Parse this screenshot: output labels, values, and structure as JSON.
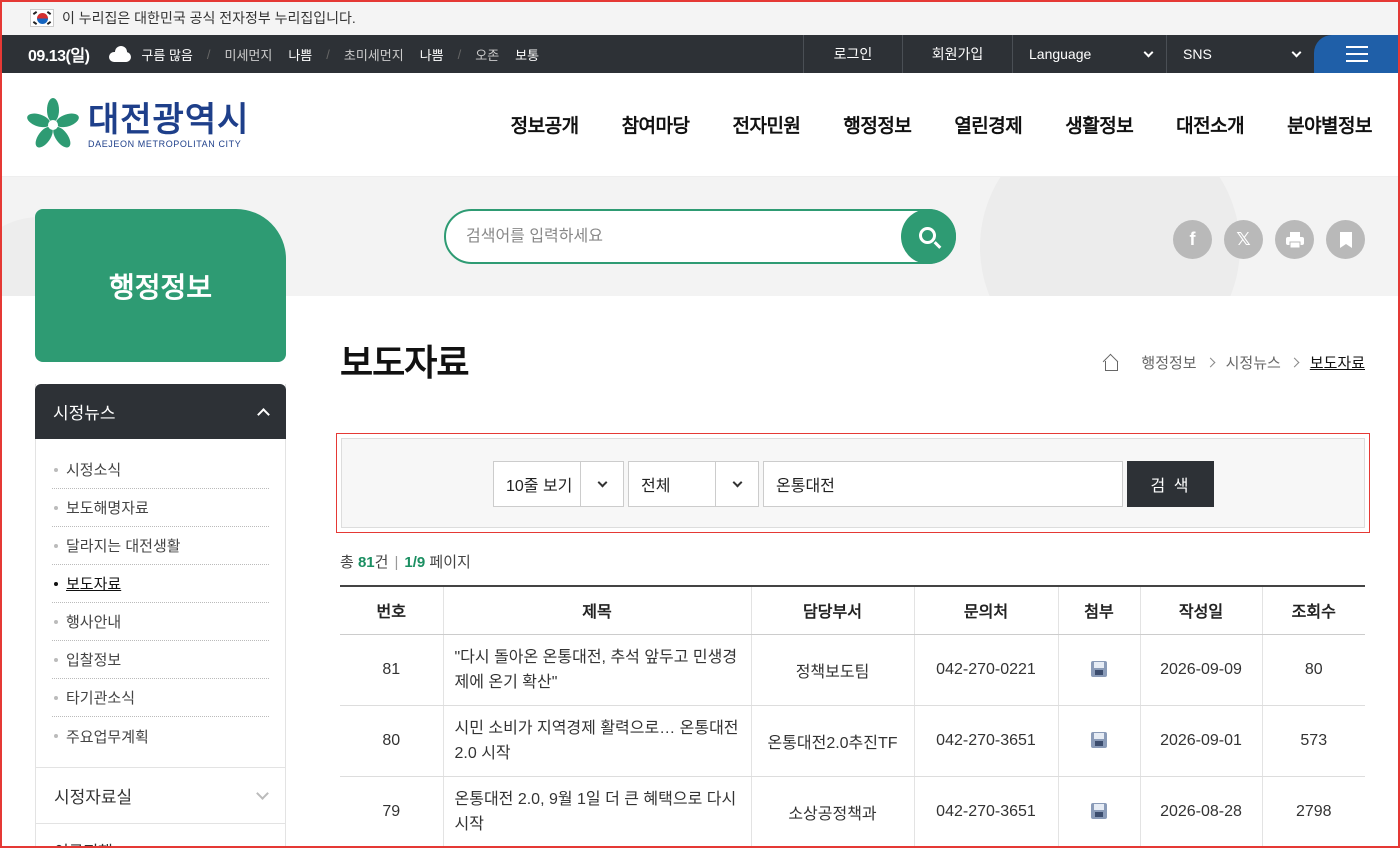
{
  "gov_banner": {
    "text": "이 누리집은 대한민국 공식 전자정부 누리집입니다."
  },
  "topbar": {
    "date": "09.13(일)",
    "weather": "구름 많음",
    "fine_dust_label": "미세먼지",
    "fine_dust_value": "나쁨",
    "ultrafine_label": "초미세먼지",
    "ultrafine_value": "나쁨",
    "ozone_label": "오존",
    "ozone_value": "보통",
    "login": "로그인",
    "signup": "회원가입",
    "language": "Language",
    "sns": "SNS"
  },
  "header": {
    "logo_ko": "대전광역시",
    "logo_en": "DAEJEON METROPOLITAN CITY",
    "gnb": [
      "정보공개",
      "참여마당",
      "전자민원",
      "행정정보",
      "열린경제",
      "생활정보",
      "대전소개",
      "분야별정보"
    ]
  },
  "search": {
    "placeholder": "검색어를 입력하세요"
  },
  "side": {
    "title": "행정정보",
    "section": "시정뉴스",
    "items": [
      "시정소식",
      "보도해명자료",
      "달라지는 대전생활",
      "보도자료",
      "행사안내",
      "입찰정보",
      "타기관소식",
      "주요업무계획"
    ],
    "active_index": 3,
    "next_section": "시정자료실",
    "next_section2": "이공지행"
  },
  "page": {
    "title": "보도자료",
    "breadcrumb": [
      "행정정보",
      "시정뉴스",
      "보도자료"
    ]
  },
  "filter": {
    "rows_select": "10줄 보기",
    "field_select": "전체",
    "keyword": "온통대전",
    "search_button": "검 색"
  },
  "summary": {
    "total_prefix": "총 ",
    "total": "81",
    "total_suffix": "건",
    "page": "1/9",
    "page_suffix": " 페이지"
  },
  "table": {
    "headers": [
      "번호",
      "제목",
      "담당부서",
      "문의처",
      "첨부",
      "작성일",
      "조회수"
    ],
    "rows": [
      {
        "no": "81",
        "title": "\"다시 돌아온 온통대전, 추석 앞두고 민생경제에 온기 확산\"",
        "dept": "정책보도팀",
        "tel": "042-270-0221",
        "date": "2026-09-09",
        "views": "80"
      },
      {
        "no": "80",
        "title": "시민 소비가 지역경제 활력으로… 온통대전 2.0 시작",
        "dept": "온통대전2.0추진TF",
        "tel": "042-270-3651",
        "date": "2026-09-01",
        "views": "573"
      },
      {
        "no": "79",
        "title": "온통대전 2.0, 9월 1일 더 큰 혜택으로 다시 시작",
        "dept": "소상공정책과",
        "tel": "042-270-3651",
        "date": "2026-08-28",
        "views": "2798"
      }
    ]
  },
  "colors": {
    "brand_green": "#2e9b73",
    "dark": "#2d3136",
    "blue": "#1f5fa8"
  }
}
